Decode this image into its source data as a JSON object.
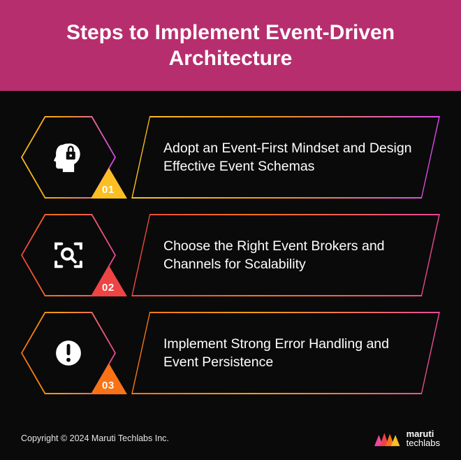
{
  "header": {
    "title": "Steps to Implement Event-Driven Architecture"
  },
  "steps": [
    {
      "number": "01",
      "icon": "head-lock-icon",
      "text": "Adopt an Event-First Mindset and Design Effective Event Schemas"
    },
    {
      "number": "02",
      "icon": "scan-search-icon",
      "text": "Choose the Right Event Brokers and Channels for Scalability"
    },
    {
      "number": "03",
      "icon": "alert-icon",
      "text": "Implement Strong Error Handling and Event Persistence"
    }
  ],
  "footer": {
    "copyright": "Copyright © 2024 Maruti Techlabs Inc.",
    "logo_primary": "maruti",
    "logo_secondary": "techlabs"
  }
}
